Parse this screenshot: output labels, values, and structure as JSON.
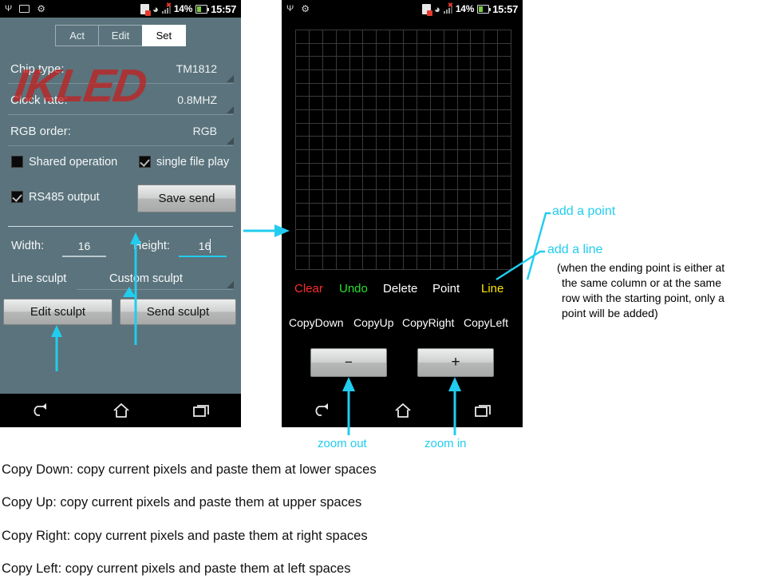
{
  "status_bar": {
    "usb_icon": "usb-icon",
    "image_icon": "image-icon",
    "android_icon": "android-icon",
    "sd_icon": "sd-card-error-icon",
    "wifi_icon": "wifi-icon",
    "signal_icon": "signal-bars-icon",
    "battery_percent": "14%",
    "battery_icon": "battery-icon",
    "time": "15:57"
  },
  "left_phone": {
    "watermark": "IKLED",
    "tabs": [
      {
        "label": "Act",
        "active": false
      },
      {
        "label": "Edit",
        "active": false
      },
      {
        "label": "Set",
        "active": true
      }
    ],
    "settings": [
      {
        "label": "Chip type:",
        "value": "TM1812"
      },
      {
        "label": "Clock rate:",
        "value": "0.8MHZ"
      },
      {
        "label": "RGB order:",
        "value": "RGB"
      }
    ],
    "checkboxes": [
      {
        "label": "Shared operation",
        "checked": false
      },
      {
        "label": "single file play",
        "checked": true
      },
      {
        "label": "RS485 output",
        "checked": true
      }
    ],
    "save_send_label": "Save send",
    "dimensions": {
      "width_label": "Width:",
      "width_value": "16",
      "height_label": "Height:",
      "height_value": "16"
    },
    "sculpt_modes": [
      {
        "label": "Line sculpt"
      },
      {
        "label": "Custom sculpt"
      }
    ],
    "buttons": [
      {
        "label": "Edit sculpt"
      },
      {
        "label": "Send sculpt"
      }
    ]
  },
  "right_phone": {
    "grid": {
      "columns": 16,
      "rows": 18
    },
    "tool_row": [
      {
        "label": "Clear",
        "color": "#ff2d2d"
      },
      {
        "label": "Undo",
        "color": "#27e02b"
      },
      {
        "label": "Delete",
        "color": "#ffffff"
      },
      {
        "label": "Point",
        "color": "#ffffff"
      },
      {
        "label": "Line",
        "color": "#ffe500"
      }
    ],
    "copy_row": [
      {
        "label": "CopyDown"
      },
      {
        "label": "CopyUp"
      },
      {
        "label": "CopyRight"
      },
      {
        "label": "CopyLeft"
      }
    ],
    "zoom_buttons": [
      {
        "label": "−"
      },
      {
        "label": "+"
      }
    ]
  },
  "nav_bar": {
    "back_icon": "back-arrow-icon",
    "home_icon": "home-icon",
    "recents_icon": "recent-apps-icon"
  },
  "annotations": {
    "add_point": "add a point",
    "add_line": "add a line",
    "line_note": "(when the ending point is either at\n the same column or at the same\n row with the starting point, only a\n point will be added)",
    "line_note_lines": [
      "(when the ending point is either at",
      "the same column or at the same",
      "row with the starting point, only a",
      "point will be added)"
    ],
    "zoom_out": "zoom out",
    "zoom_in": "zoom in",
    "accent_color": "#21cdee"
  },
  "bottom_notes": [
    "Copy Down: copy current pixels and paste them at lower spaces",
    "Copy Up: copy current pixels and paste them at upper spaces",
    "Copy Right: copy current pixels and paste them at right spaces",
    "Copy Left: copy current pixels and paste them at left spaces"
  ]
}
